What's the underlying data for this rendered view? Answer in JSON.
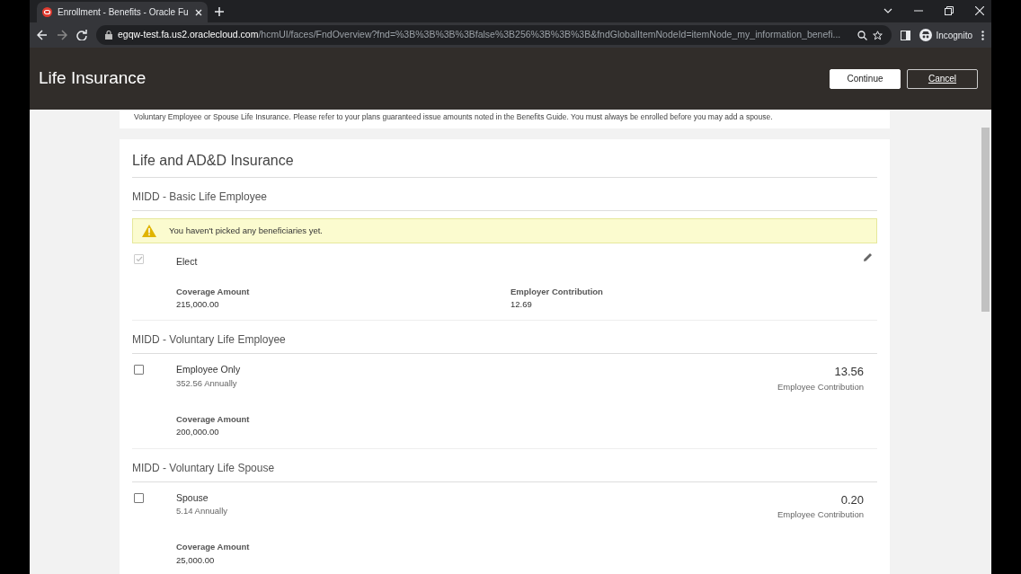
{
  "browser": {
    "tab_title": "Enrollment - Benefits - Oracle Fu",
    "url_host": "egqw-test.fa.us2.oraclecloud.com",
    "url_path": "/hcmUI/faces/FndOverview?fnd=%3B%3B%3B%3Bfalse%3B256%3B%3B%3B&fndGlobalItemNodeId=itemNode_my_information_benefi...",
    "profile": "Incognito"
  },
  "header": {
    "title": "Life Insurance",
    "buttons": [
      {
        "label": "Continue",
        "kind": "primary"
      },
      {
        "label": "Cancel",
        "kind": "secondary"
      }
    ]
  },
  "notice": "Voluntary Employee or Spouse Life Insurance. Please refer to your plans guaranteed issue amounts noted in the Benefits Guide. You must always be enrolled before you may add a spouse.",
  "section_title": "Life and AD&D Insurance",
  "plans": [
    {
      "title": "MIDD - Basic Life Employee",
      "warning": "You haven't picked any beneficiaries yet.",
      "options": [
        {
          "label": "Elect",
          "checked": true,
          "disabled": true,
          "editable": true,
          "details": [
            {
              "label": "Coverage Amount",
              "value": "215,000.00"
            },
            {
              "label": "Employer Contribution",
              "value": "12.69"
            }
          ]
        }
      ]
    },
    {
      "title": "MIDD - Voluntary Life Employee",
      "options": [
        {
          "label": "Employee Only",
          "checked": false,
          "disabled": false,
          "sub": "352.56 Annually",
          "amount": "13.56",
          "amount_label": "Employee Contribution",
          "details": [
            {
              "label": "Coverage Amount",
              "value": "200,000.00"
            }
          ]
        }
      ]
    },
    {
      "title": "MIDD - Voluntary Life Spouse",
      "options": [
        {
          "label": "Spouse",
          "checked": false,
          "disabled": false,
          "sub": "5.14 Annually",
          "amount": "0.20",
          "amount_label": "Employee Contribution",
          "details": [
            {
              "label": "Coverage Amount",
              "value": "25,000.00"
            }
          ]
        }
      ]
    }
  ]
}
